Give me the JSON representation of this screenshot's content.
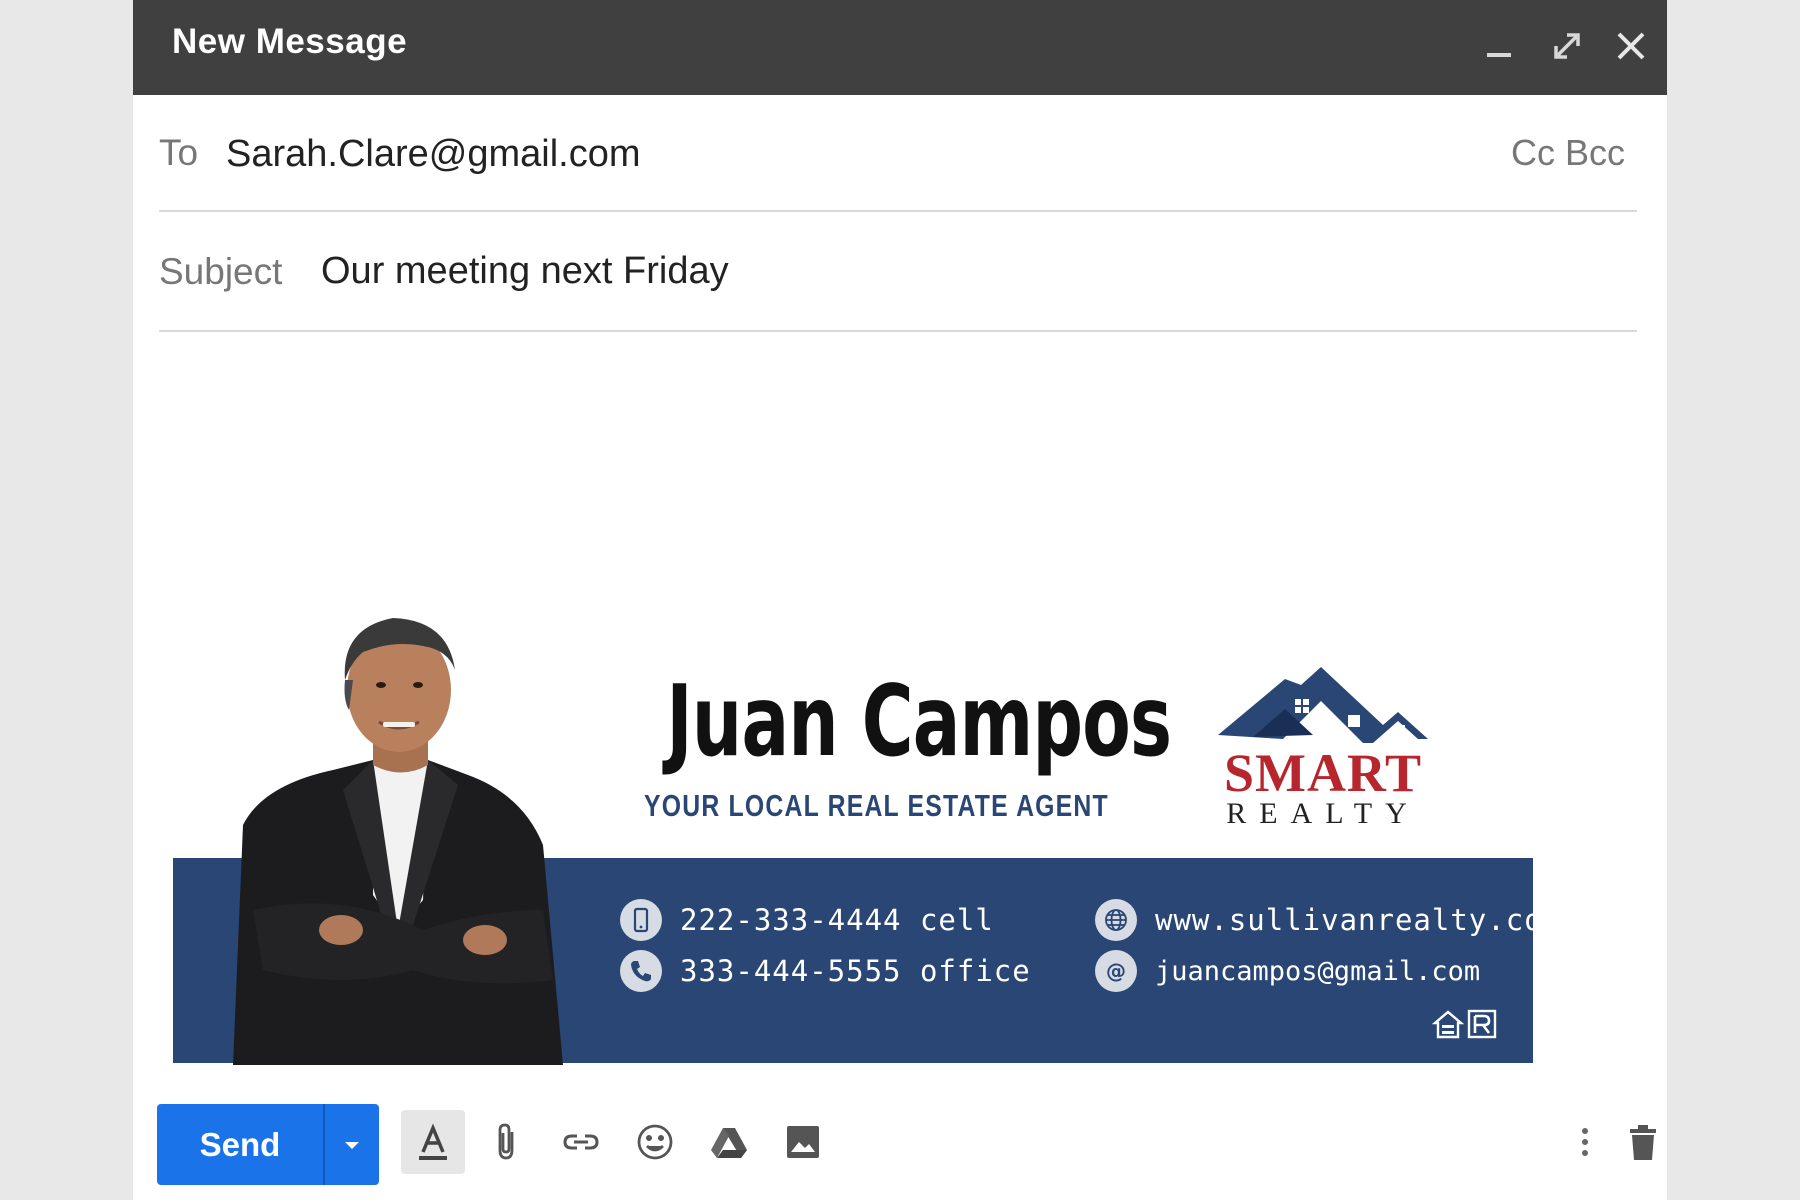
{
  "window": {
    "title": "New Message",
    "controls": [
      "minimize-icon",
      "expand-icon",
      "close-icon"
    ]
  },
  "to": {
    "label": "To",
    "value": "Sarah.Clare@gmail.com",
    "cc_label": "Cc",
    "bcc_label": "Bcc"
  },
  "subject": {
    "label": "Subject",
    "value": "Our meeting next Friday"
  },
  "signature": {
    "name": "Juan Campos",
    "tagline": "YOUR LOCAL REAL ESTATE AGENT",
    "logo_text_1": "SMART",
    "logo_text_2": "REALTY",
    "phone_cell": "222-333-4444 cell",
    "phone_office": "333-444-5555 office",
    "website": "www.sullivanrealty.com",
    "email": "juancampos@gmail.com",
    "colors": {
      "band": "#294675",
      "logo_red": "#b7262d"
    }
  },
  "toolbar": {
    "send_label": "Send",
    "icons": [
      "text-format-icon",
      "attach-icon",
      "link-icon",
      "emoji-icon",
      "drive-icon",
      "photo-icon",
      "more-options-icon",
      "trash-icon"
    ],
    "accent": "#1a73e8"
  }
}
